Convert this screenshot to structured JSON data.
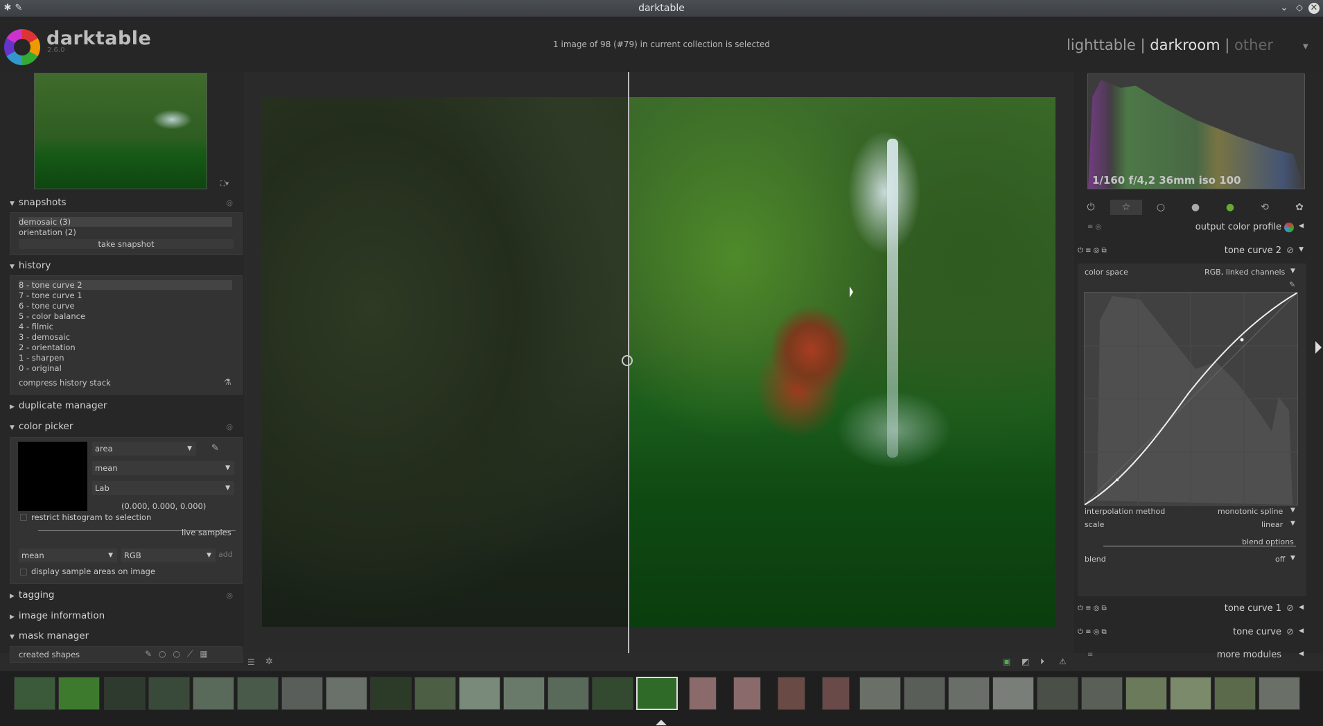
{
  "window": {
    "title": "darktable"
  },
  "app": {
    "name": "darktable",
    "version": "2.6.0"
  },
  "status": "1 image of 98 (#79) in current collection is selected",
  "views": {
    "lighttable": "lighttable",
    "sep1": "|",
    "darkroom": "darkroom",
    "sep2": "|",
    "other": "other"
  },
  "snapshots": {
    "title": "snapshots",
    "items": [
      "demosaic (3)",
      "orientation (2)"
    ],
    "take_label": "take snapshot"
  },
  "history": {
    "title": "history",
    "items": [
      "8 - tone curve 2",
      "7 - tone curve 1",
      "6 - tone curve",
      "5 - color balance",
      "4 - filmic",
      "3 - demosaic",
      "2 - orientation",
      "1 - sharpen",
      "0 - original"
    ],
    "compress_label": "compress history stack"
  },
  "duplicate_manager": {
    "title": "duplicate manager"
  },
  "color_picker": {
    "title": "color picker",
    "mode": "area",
    "stat": "mean",
    "space": "Lab",
    "value": "(0.000, 0.000, 0.000)",
    "restrict_label": "restrict histogram to selection",
    "live_samples": "live samples",
    "sample_stat": "mean",
    "sample_space": "RGB",
    "add_label": "add",
    "display_label": "display sample areas on image"
  },
  "tagging": {
    "title": "tagging"
  },
  "image_information": {
    "title": "image information"
  },
  "mask_manager": {
    "title": "mask manager",
    "created_shapes": "created shapes"
  },
  "histogram": {
    "exif": "1/160 f/4,2 36mm iso 100"
  },
  "modules": {
    "output_color_profile": "output color profile",
    "tone_curve_2": "tone curve 2",
    "color_space_label": "color space",
    "color_space_value": "RGB, linked channels",
    "interpolation_label": "interpolation method",
    "interpolation_value": "monotonic spline",
    "scale_label": "scale",
    "scale_value": "linear",
    "blend_options": "blend options",
    "blend_label": "blend",
    "blend_value": "off",
    "tone_curve_1": "tone curve 1",
    "tone_curve": "tone curve",
    "more_modules": "more modules"
  },
  "colors": {
    "accent": "#e0e0e0",
    "panel": "#272727",
    "title_bar": "#44494e"
  }
}
